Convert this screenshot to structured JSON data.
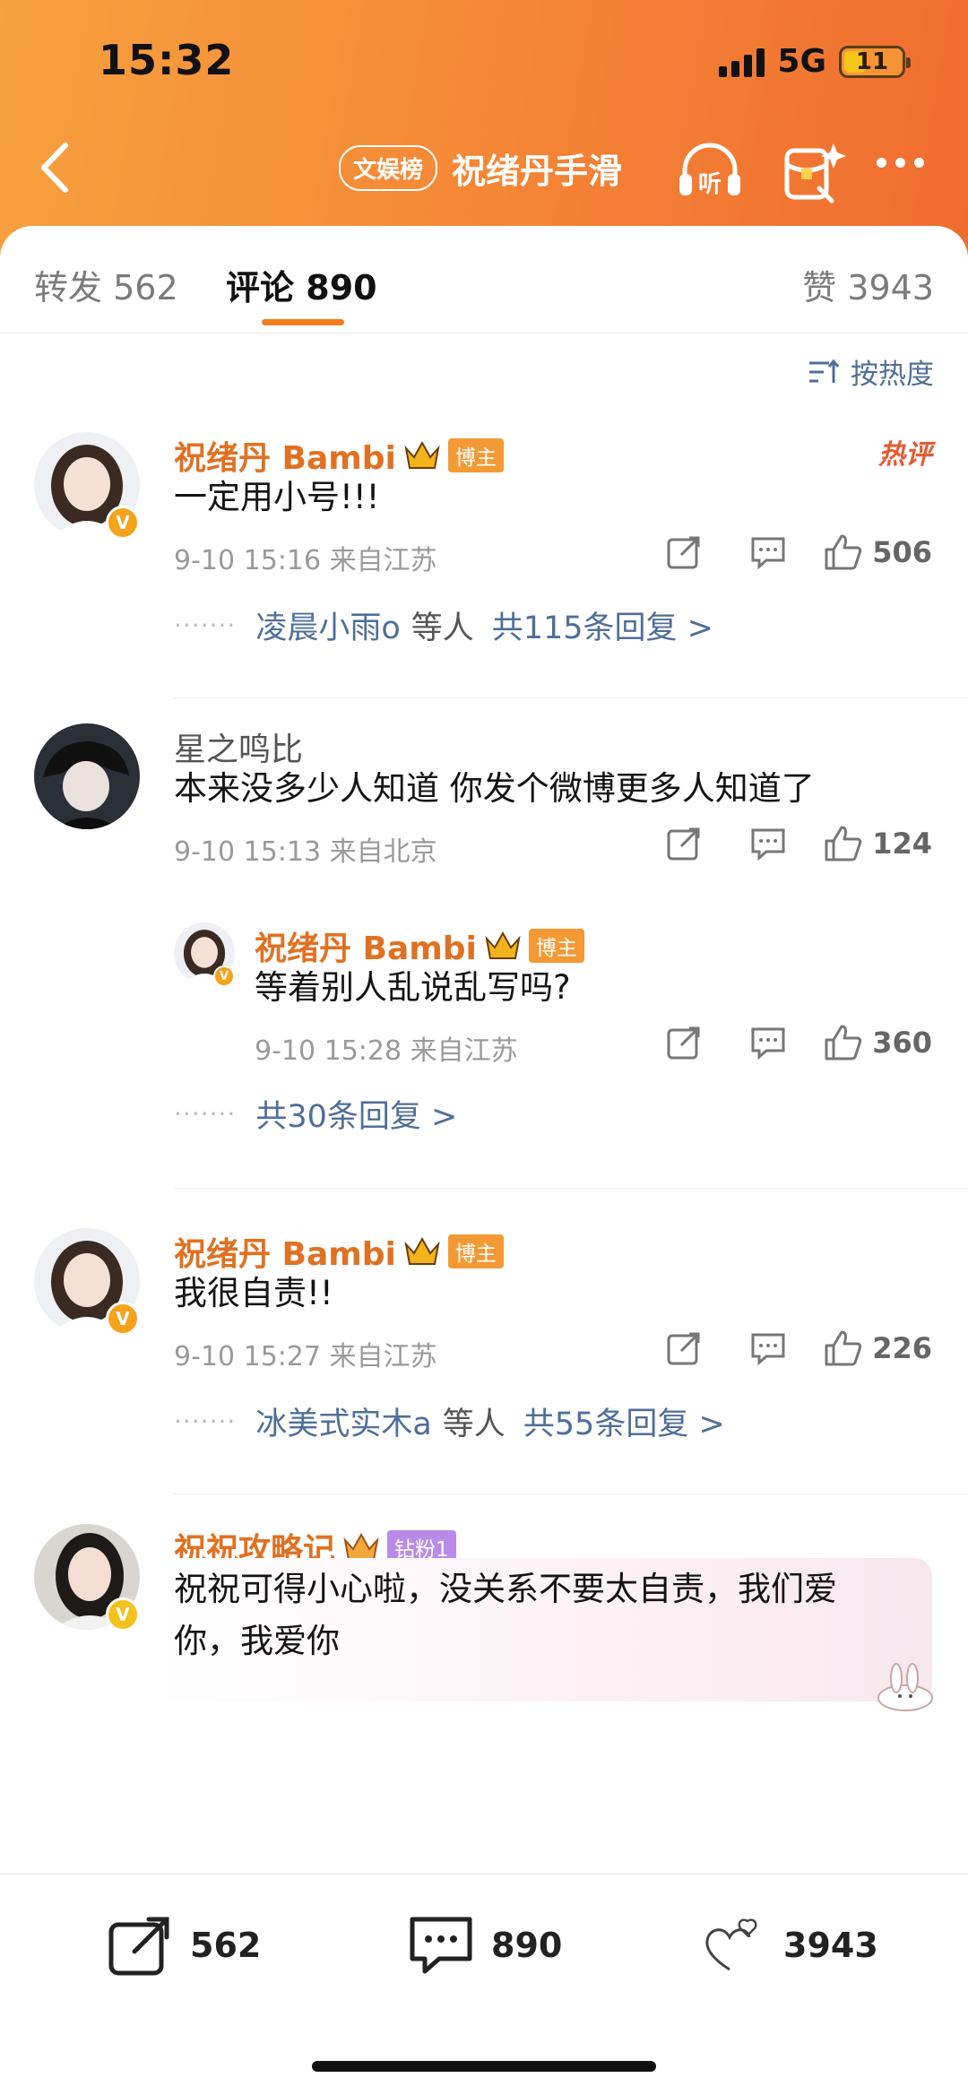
{
  "status_bar": {
    "time": "15:32",
    "network": "5G",
    "battery": "11"
  },
  "nav": {
    "topic_badge": "文娱榜",
    "title": "祝绪丹手滑",
    "listen_label": "听"
  },
  "tabs": {
    "repost_label": "转发",
    "repost_count": "562",
    "comment_label": "评论",
    "comment_count": "890",
    "like_label": "赞",
    "like_count": "3943"
  },
  "sort_label": "按热度",
  "colors": {
    "brand_orange": "#f47b20",
    "link_blue": "#4f6f98",
    "name_orange": "#e07122"
  },
  "comments": [
    {
      "user": "祝绪丹 Bambi",
      "badge": "博主",
      "hot_tag": "热评",
      "text": "一定用小号!!!",
      "meta": "9-10 15:16  来自江苏",
      "likes": "506",
      "reply_users": "凌晨小雨o",
      "reply_etc": "等人",
      "reply_total": "共115条回复 >"
    },
    {
      "user": "星之鸣比",
      "text": "本来没多少人知道 你发个微博更多人知道了",
      "meta": "9-10 15:13  来自北京",
      "likes": "124",
      "sub_reply": {
        "user": "祝绪丹 Bambi",
        "badge": "博主",
        "text": "等着别人乱说乱写吗?",
        "meta": "9-10 15:28  来自江苏",
        "likes": "360"
      },
      "reply_total": "共30条回复 >"
    },
    {
      "user": "祝绪丹 Bambi",
      "badge": "博主",
      "text": "我很自责!!",
      "meta": "9-10 15:27  来自江苏",
      "likes": "226",
      "reply_users": "冰美式实木a",
      "reply_etc": "等人",
      "reply_total": "共55条回复 >"
    },
    {
      "user": "祝祝攻略记",
      "badge": "钻粉1",
      "text_line1": "祝祝可得小心啦，没关系不要太自责，我们爱",
      "text_line2": "你，我爱你"
    }
  ],
  "bottom_bar": {
    "repost": "562",
    "comment": "890",
    "like": "3943"
  }
}
